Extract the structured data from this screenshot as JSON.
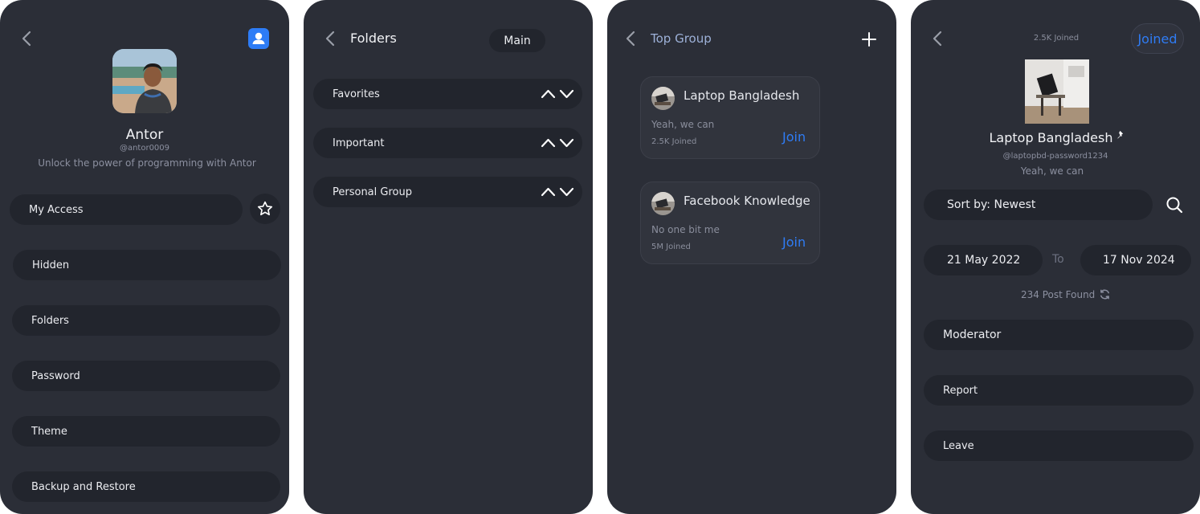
{
  "profile_screen": {
    "name": "Antor",
    "handle": "@antor0009",
    "tagline": "Unlock the power of programming with Antor",
    "my_access_label": "My Access",
    "menu": [
      {
        "label": "Hidden"
      },
      {
        "label": "Folders"
      },
      {
        "label": "Password"
      },
      {
        "label": "Theme"
      },
      {
        "label": "Backup and Restore"
      }
    ]
  },
  "folders_screen": {
    "title": "Folders",
    "main_chip": "Main",
    "folders": [
      {
        "label": "Favorites"
      },
      {
        "label": "Important"
      },
      {
        "label": "Personal Group"
      }
    ]
  },
  "top_group_screen": {
    "title": "Top Group",
    "groups": [
      {
        "name": "Laptop Bangladesh",
        "description": "Yeah, we can",
        "joined": "2.5K Joined",
        "join_label": "Join"
      },
      {
        "name": "Facebook Knowledge",
        "description": "No one bit me",
        "joined": "5M Joined",
        "join_label": "Join"
      }
    ]
  },
  "group_detail_screen": {
    "joined_count": "2.5K Joined",
    "joined_button": "Joined",
    "name": "Laptop Bangladesh",
    "handle": "@laptopbd-password1234",
    "description": "Yeah, we can",
    "sort_label": "Sort by: Newest",
    "date_from": "21 May 2022",
    "date_to_label": "To",
    "date_to": "17 Nov 2024",
    "posts_found": "234 Post Found",
    "actions": [
      {
        "label": "Moderator"
      },
      {
        "label": "Report"
      },
      {
        "label": "Leave"
      }
    ]
  },
  "colors": {
    "panel_bg": "#2b2e37",
    "pill_bg": "#22252d",
    "accent_blue": "#2f7cf5",
    "muted_text": "#8c90a0"
  },
  "icons": [
    "back-arrow-icon",
    "user-icon",
    "star-icon",
    "chevron-up-icon",
    "chevron-down-icon",
    "plus-icon",
    "pin-icon",
    "search-icon",
    "refresh-icon"
  ]
}
